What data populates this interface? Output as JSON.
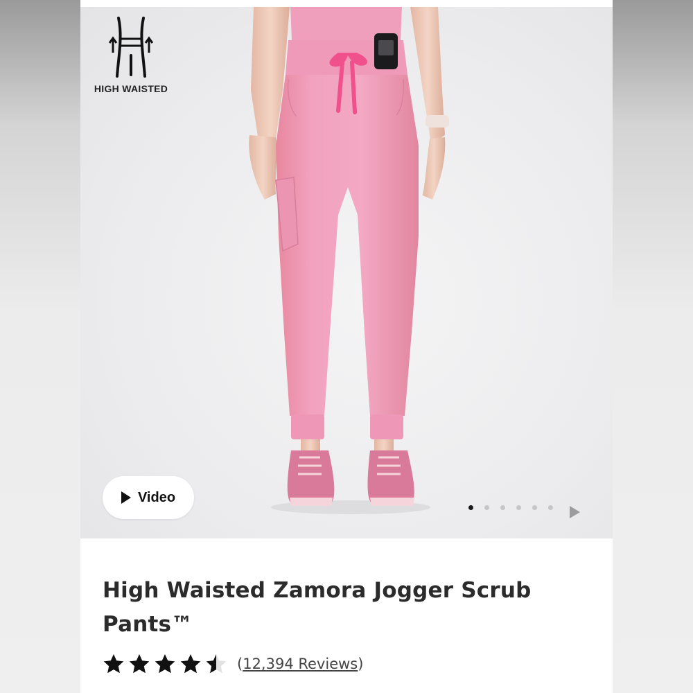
{
  "badge": {
    "icon": "high-waist-icon",
    "label": "HIGH WAISTED"
  },
  "video_button": {
    "label": "Video",
    "icon": "play-icon"
  },
  "carousel": {
    "total_slides": 6,
    "active_index": 0,
    "next_icon": "play-arrow-icon"
  },
  "product": {
    "title_line1": "High Waisted Zamora Jogger Scrub",
    "title_line2": "Pants™",
    "rating_value": 4.5,
    "rating_max": 5,
    "reviews_open": "(",
    "reviews_link": "12,394 Reviews",
    "reviews_close": ")"
  },
  "colors": {
    "scrub_pink": "#f2a2bf",
    "drawstring": "#f0508c",
    "star": "#111111"
  }
}
